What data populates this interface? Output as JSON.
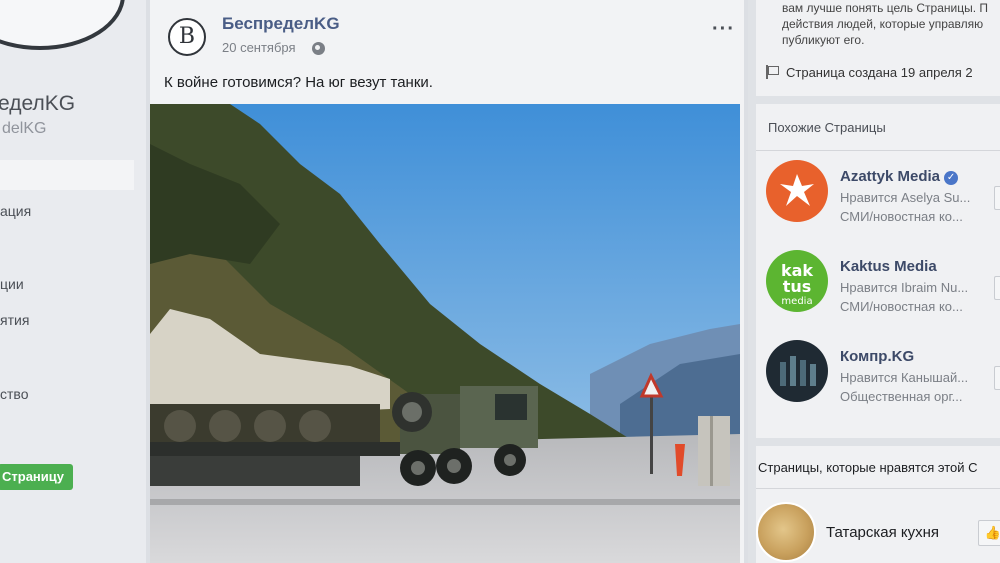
{
  "left": {
    "page_name": "еделKG",
    "page_handle": "delKG",
    "nav": [
      {
        "label": "ация"
      },
      {
        "label": "ции"
      },
      {
        "label": "ятия"
      },
      {
        "label": "ство"
      }
    ],
    "like_button": "Страницу"
  },
  "post": {
    "author": "БеспределKG",
    "avatar_letter": "B",
    "date": "20 сентября",
    "text": "К войне готовимся? На юг везут танки.",
    "more_icon": "···"
  },
  "right": {
    "about_text": "вам лучше понять цель Страницы. П действия людей, которые управляю публикуют его.",
    "created": "Страница создана 19 апреля 2",
    "similar_title": "Похожие Страницы",
    "similar": [
      {
        "name": "Azattyk Media",
        "liked_by": "Нравится Aselya Su...",
        "category": "СМИ/новостная ко...",
        "verified": true,
        "logo_color": "#e8612c"
      },
      {
        "name": "Kaktus Media",
        "liked_by": "Нравится Ibraim Nu...",
        "category": "СМИ/новостная ко...",
        "verified": false,
        "logo_color": "#5cb531",
        "logo_text": "kak tus media"
      },
      {
        "name": "Компр.KG",
        "liked_by": "Нравится Канышай...",
        "category": "Общественная орг...",
        "verified": false,
        "logo_color": "#1f2a33"
      }
    ],
    "liked_title": "Страницы, которые нравятся этой С",
    "liked": [
      {
        "name": "Татарская кухня"
      }
    ],
    "like_icon": "👍"
  }
}
